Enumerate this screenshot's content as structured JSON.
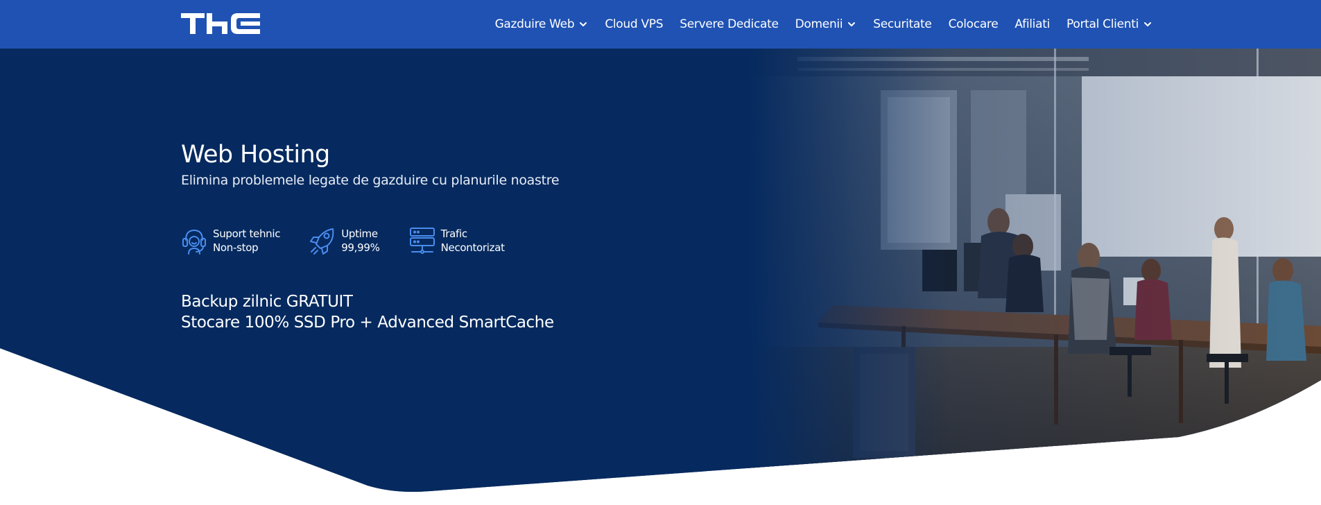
{
  "brand": {
    "logo_text": "THC"
  },
  "nav": {
    "items": [
      {
        "label": "Gazduire Web",
        "dropdown": true
      },
      {
        "label": "Cloud VPS",
        "dropdown": false
      },
      {
        "label": "Servere Dedicate",
        "dropdown": false
      },
      {
        "label": "Domenii",
        "dropdown": true
      },
      {
        "label": "Securitate",
        "dropdown": false
      },
      {
        "label": "Colocare",
        "dropdown": false
      },
      {
        "label": "Afiliati",
        "dropdown": false
      },
      {
        "label": "Portal Clienti",
        "dropdown": true
      }
    ]
  },
  "hero": {
    "title": "Web Hosting",
    "subtitle": "Elimina problemele legate de gazduire cu planurile noastre",
    "features": [
      {
        "icon": "headset-icon",
        "line1": "Suport tehnic",
        "line2": "Non-stop"
      },
      {
        "icon": "rocket-icon",
        "line1": "Uptime",
        "line2": "99,99%"
      },
      {
        "icon": "server-icon",
        "line1": "Trafic",
        "line2": "Necontorizat"
      }
    ],
    "perks": [
      "Backup zilnic GRATUIT",
      "Stocare 100% SSD Pro + Advanced SmartCache"
    ]
  },
  "colors": {
    "nav_bg": "#1f52b3",
    "hero_bg": "#062a5f",
    "icon_accent": "#4a8df0",
    "page_bg": "#ffffff"
  }
}
